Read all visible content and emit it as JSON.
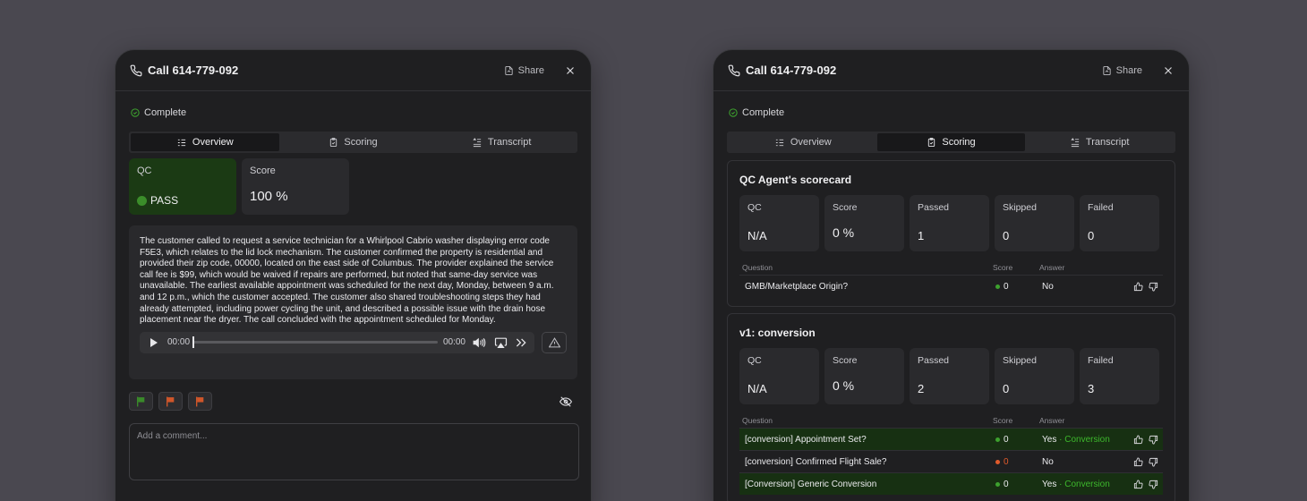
{
  "colors": {
    "background": "#4a4850",
    "panel": "#1f1f21",
    "pass_green": "#1b3a14",
    "positive_row": "#173012",
    "score_green": "#3da12e",
    "score_red": "#e05a2b",
    "flag_green": "#3a8a2a",
    "flag_orange": "#d0562a"
  },
  "left": {
    "header": {
      "title": "Call 614-779-092",
      "share_label": "Share",
      "icons": [
        "phone-icon",
        "file-icon",
        "close-icon"
      ]
    },
    "status": "Complete",
    "tabs": [
      {
        "label": "Overview",
        "icon": "list-icon",
        "active": true
      },
      {
        "label": "Scoring",
        "icon": "clipboard-icon",
        "active": false
      },
      {
        "label": "Transcript",
        "icon": "text-icon",
        "active": false
      }
    ],
    "qc": {
      "label": "QC",
      "value": "PASS"
    },
    "score": {
      "label": "Score",
      "value": "100 %"
    },
    "summary": "The customer called to request a service technician for a Whirlpool Cabrio washer displaying error code F5E3, which relates to the lid lock mechanism. The customer confirmed the property is residential and provided their zip code, 00000, located on the east side of Columbus. The provider explained the service call fee is $99, which would be waived if repairs are performed, but noted that same-day service was unavailable. The earliest available appointment was scheduled for the next day, Monday, between 9 a.m. and 12 p.m., which the customer accepted. The customer also shared troubleshooting steps they had already attempted, including power cycling the unit, and described a possible issue with the drain hose placement near the dryer. The call concluded with the appointment scheduled for Monday.",
    "player": {
      "current_time": "00:00",
      "duration": "00:00",
      "progress": 0
    },
    "comment_placeholder": "Add a comment..."
  },
  "right": {
    "header": {
      "title": "Call 614-779-092",
      "share_label": "Share"
    },
    "status": "Complete",
    "tabs": [
      {
        "label": "Overview",
        "icon": "list-icon",
        "active": false
      },
      {
        "label": "Scoring",
        "icon": "clipboard-icon",
        "active": true
      },
      {
        "label": "Transcript",
        "icon": "text-icon",
        "active": false
      }
    ],
    "column_headers": {
      "question": "Question",
      "score": "Score",
      "answer": "Answer"
    },
    "scorecards": [
      {
        "title": "QC Agent's scorecard",
        "stats": [
          {
            "label": "QC",
            "value": "N/A"
          },
          {
            "label": "Score",
            "value": "0 %"
          },
          {
            "label": "Passed",
            "value": "1"
          },
          {
            "label": "Skipped",
            "value": "0"
          },
          {
            "label": "Failed",
            "value": "0"
          }
        ],
        "rows": [
          {
            "question": "GMB/Marketplace Origin?",
            "score": "0",
            "score_color": "green",
            "answer": "No",
            "tag": "",
            "highlight": false
          }
        ]
      },
      {
        "title": "v1: conversion",
        "stats": [
          {
            "label": "QC",
            "value": "N/A"
          },
          {
            "label": "Score",
            "value": "0 %"
          },
          {
            "label": "Passed",
            "value": "2"
          },
          {
            "label": "Skipped",
            "value": "0"
          },
          {
            "label": "Failed",
            "value": "3"
          }
        ],
        "rows": [
          {
            "question": "[conversion] Appointment Set?",
            "score": "0",
            "score_color": "green",
            "answer": "Yes",
            "tag": "· Conversion",
            "highlight": true
          },
          {
            "question": "[conversion] Confirmed Flight Sale?",
            "score": "0",
            "score_color": "red",
            "answer": "No",
            "tag": "",
            "highlight": false
          },
          {
            "question": "[Conversion] Generic Conversion",
            "score": "0",
            "score_color": "green",
            "answer": "Yes",
            "tag": "· Conversion",
            "highlight": true
          }
        ]
      }
    ]
  }
}
